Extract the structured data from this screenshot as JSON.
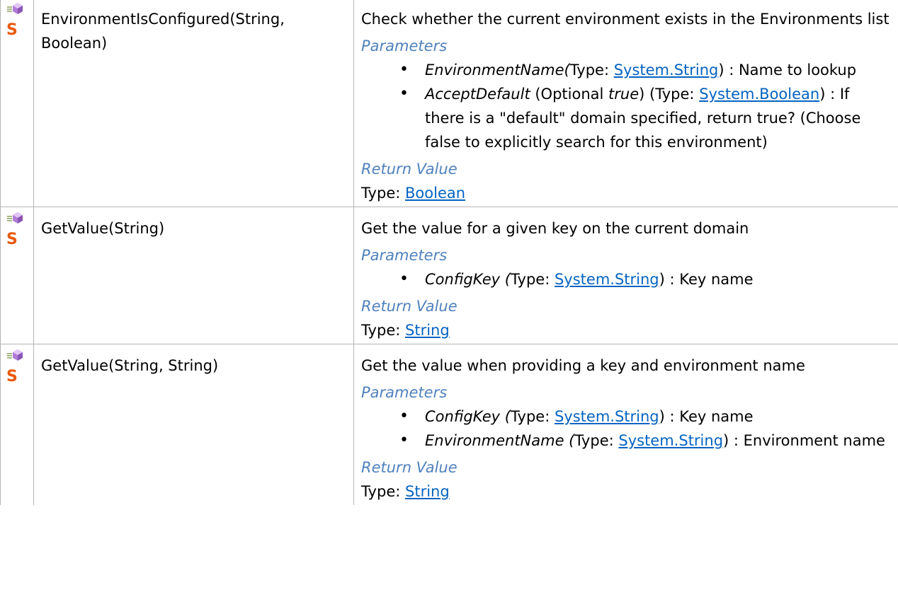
{
  "rows": [
    {
      "name": "EnvironmentIsConfigured(String, Boolean)",
      "summary": "Check whether the current environment exists in the Environments list",
      "parameters_heading": "Parameters",
      "return_heading": "Return Value",
      "params": [
        {
          "name": "EnvironmentName(",
          "type_prefix": "Type: ",
          "type_link": "System.String",
          "suffix": ") : Name to lookup"
        },
        {
          "name": "AcceptDefault",
          "optional_prefix": " (Optional ",
          "optional_value": "true",
          "optional_suffix": ") (",
          "type_prefix": "Type: ",
          "type_link": "System.Boolean",
          "suffix": ") : If there is a \"default\" domain specified, return true? (Choose false to explicitly search for this environment)"
        }
      ],
      "return_type_prefix": "Type: ",
      "return_type_link": "Boolean"
    },
    {
      "name": "GetValue(String)",
      "summary": "Get the value for a given key on the current domain",
      "parameters_heading": "Parameters",
      "return_heading": "Return Value",
      "params": [
        {
          "name": "ConfigKey (",
          "type_prefix": "Type: ",
          "type_link": "System.String",
          "suffix": ") : Key name"
        }
      ],
      "return_type_prefix": "Type: ",
      "return_type_link": "String"
    },
    {
      "name": "GetValue(String, String)",
      "summary": "Get the value when providing a key and environment name",
      "parameters_heading": "Parameters",
      "return_heading": "Return Value",
      "params": [
        {
          "name": "ConfigKey (",
          "type_prefix": "Type: ",
          "type_link": "System.String",
          "suffix": ") : Key name"
        },
        {
          "name": "EnvironmentName (",
          "type_prefix": "Type: ",
          "type_link": "System.String",
          "suffix": ") : Environment name"
        }
      ],
      "return_type_prefix": "Type: ",
      "return_type_link": "String"
    }
  ],
  "icons": {
    "method": "public-method-icon",
    "static": "static-member-icon",
    "static_glyph": "S",
    "bullet": "•"
  },
  "colors": {
    "section_heading": "#4f81bd",
    "link": "#0563c1",
    "static_icon": "#e8590c",
    "method_icon": "#b07cd8",
    "border": "#b4b4b4"
  }
}
